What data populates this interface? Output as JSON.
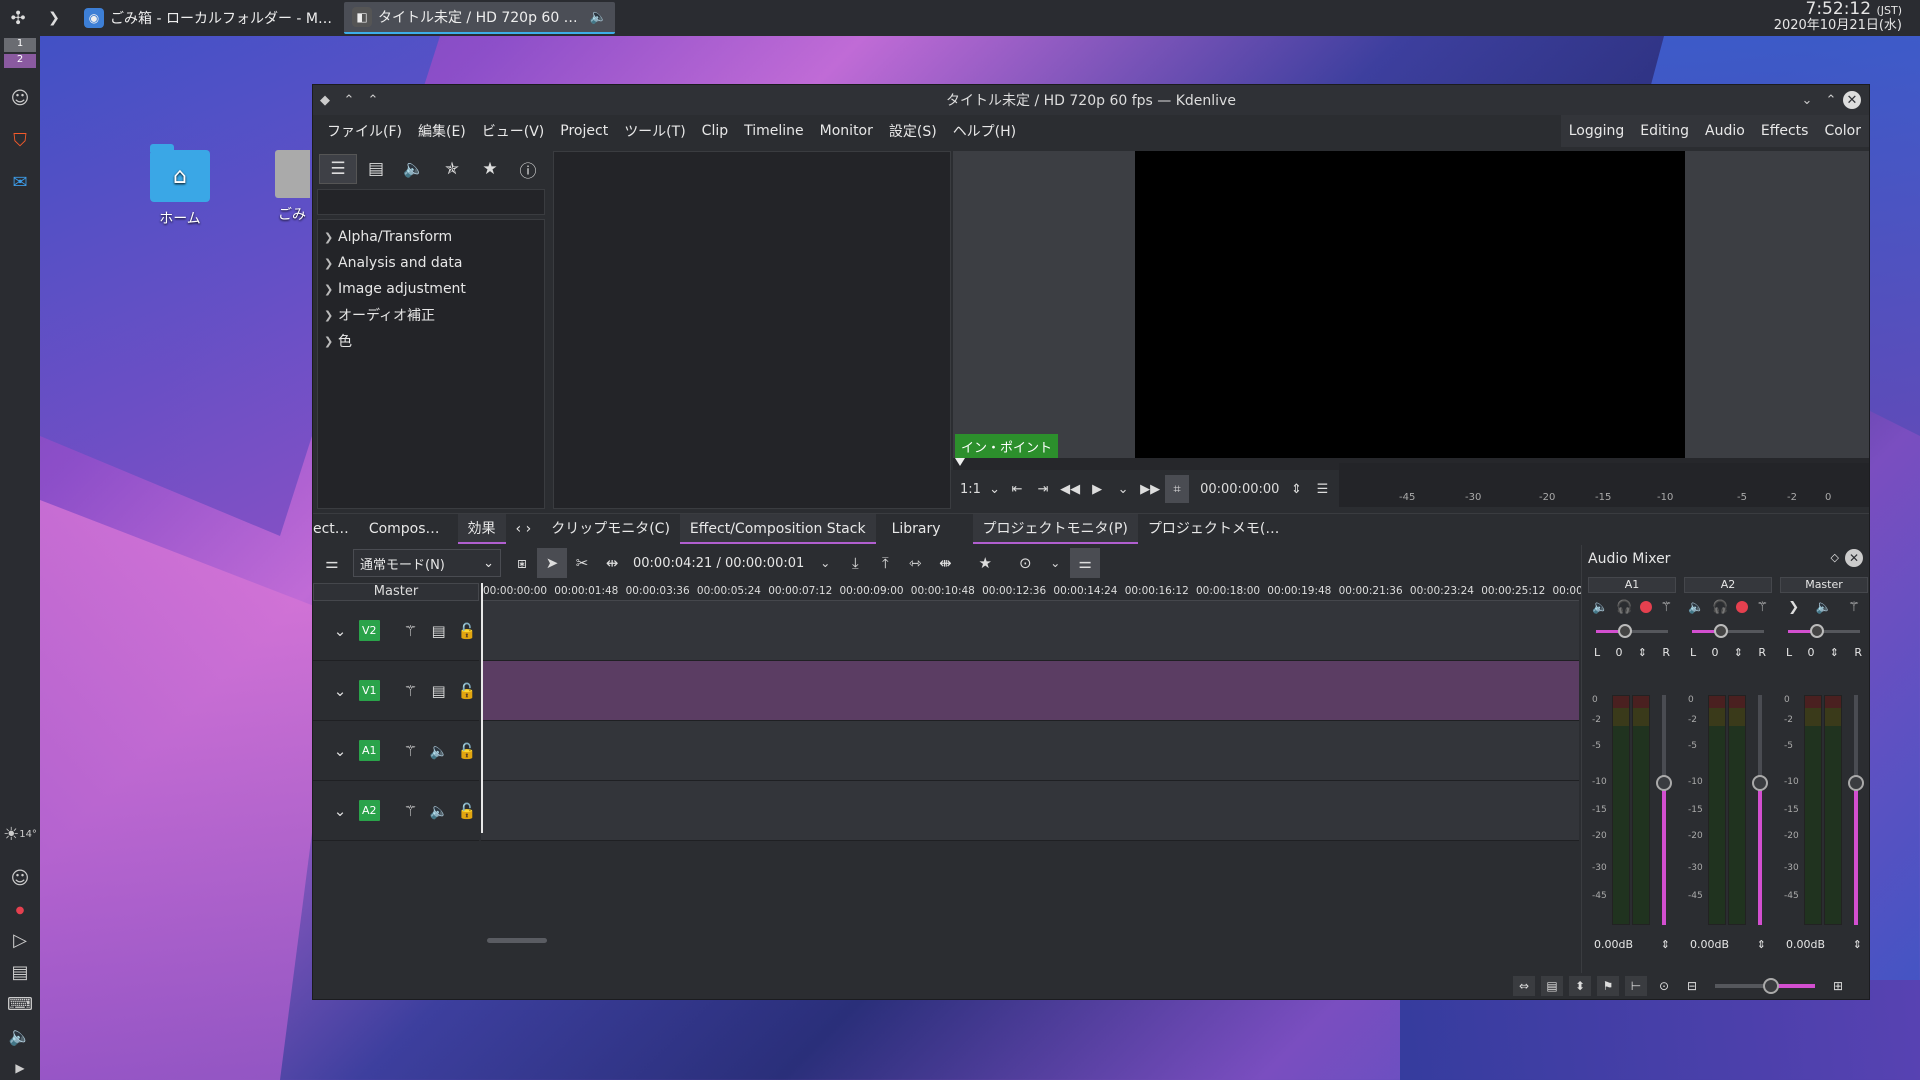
{
  "taskbar": {
    "tasks": [
      {
        "label": "ごみ箱 - ローカルフォルダー - M…",
        "icon": "dolphin-icon"
      },
      {
        "label": "タイトル未定 / HD 720p 60 …",
        "icon": "kdenlive-icon"
      }
    ],
    "clock_time": "7:52:12",
    "clock_tz": "(JST)",
    "clock_date": "2020年10月21日(水)"
  },
  "dock": {
    "pager": [
      "1",
      "2"
    ],
    "weather_temp": "14°"
  },
  "desktop": {
    "icons": [
      {
        "label": "ホーム",
        "icon": "home-folder-icon"
      },
      {
        "label": "ごみ",
        "icon": "trash-icon"
      }
    ]
  },
  "window": {
    "title": "タイトル未定 / HD 720p 60 fps — Kdenlive",
    "menus": [
      "ファイル(F)",
      "編集(E)",
      "ビュー(V)",
      "Project",
      "ツール(T)",
      "Clip",
      "Timeline",
      "Monitor",
      "設定(S)",
      "ヘルプ(H)"
    ],
    "layouts": [
      "Logging",
      "Editing",
      "Audio",
      "Effects",
      "Color"
    ]
  },
  "effects": {
    "categories": [
      "Alpha/Transform",
      "Analysis and data",
      "Image adjustment",
      "オーディオ補正",
      "色"
    ]
  },
  "monitor": {
    "in_point_label": "イン・ポイント",
    "zoom": "1:1",
    "timecode": "00:00:00:00",
    "meter_labels": [
      "-45",
      "-30",
      "-20",
      "-15",
      "-10",
      "-5",
      "-2",
      "0"
    ]
  },
  "tabs": [
    "ect…",
    "Compos…",
    "効果",
    "クリップモニタ(C)",
    "Effect/Composition Stack",
    "Library",
    "プロジェクトモニタ(P)",
    "プロジェクトメモ(…"
  ],
  "timeline": {
    "mode": "通常モード(N)",
    "timecode": "00:00:04:21 / 00:00:00:01",
    "master_label": "Master",
    "ruler": [
      "00:00:00:00",
      "00:00:01:48",
      "00:00:03:36",
      "00:00:05:24",
      "00:00:07:12",
      "00:00:09:00",
      "00:00:10:48",
      "00:00:12:36",
      "00:00:14:24",
      "00:00:16:12",
      "00:00:18:00",
      "00:00:19:48",
      "00:00:21:36",
      "00:00:23:24",
      "00:00:25:12",
      "00:00"
    ],
    "tracks": [
      {
        "tag": "V2",
        "type": "video"
      },
      {
        "tag": "V1",
        "type": "video"
      },
      {
        "tag": "A1",
        "type": "audio"
      },
      {
        "tag": "A2",
        "type": "audio"
      }
    ]
  },
  "mixer": {
    "title": "Audio Mixer",
    "strips": [
      {
        "name": "A1",
        "l": "L",
        "val": "0",
        "r": "R",
        "db": "0.00dB"
      },
      {
        "name": "A2",
        "l": "L",
        "val": "0",
        "r": "R",
        "db": "0.00dB"
      },
      {
        "name": "Master",
        "l": "L",
        "val": "0",
        "r": "R",
        "db": "0.00dB"
      }
    ],
    "scale": [
      "0",
      "-2",
      "-5",
      "-10",
      "-15",
      "-20",
      "-30",
      "-45"
    ]
  },
  "colors": {
    "accent": "#b15fd0",
    "track_tag": "#2aa34a",
    "record": "#e5404f"
  }
}
